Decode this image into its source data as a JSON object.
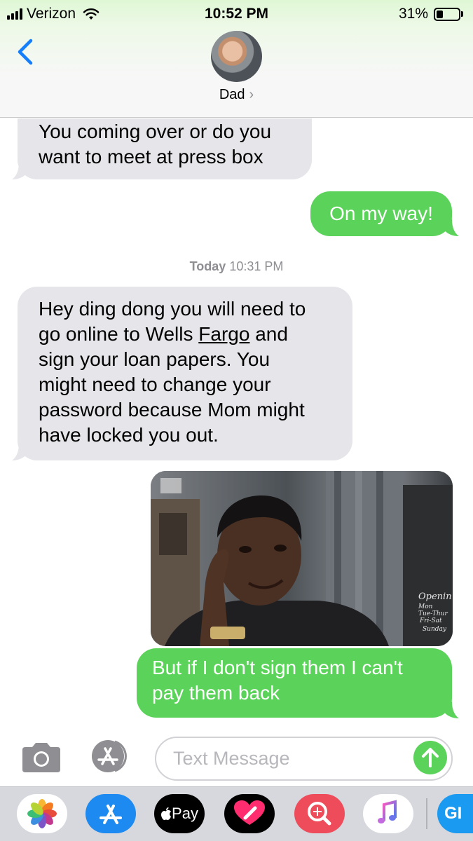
{
  "status_bar": {
    "carrier": "Verizon",
    "time": "10:52 PM",
    "battery_percent": "31%",
    "battery_level": 0.31,
    "signal_bars": 4,
    "icons": [
      "signal-icon",
      "wifi-icon",
      "battery-icon"
    ]
  },
  "header": {
    "contact_name": "Dad",
    "chevron": "›",
    "icons": [
      "back-chevron-icon",
      "contact-avatar"
    ]
  },
  "messages": {
    "m1": {
      "direction": "incoming",
      "lines": [
        "You coming over or do you",
        "want to meet at press box"
      ]
    },
    "m2": {
      "direction": "outgoing",
      "text": "On my way!"
    },
    "timestamp": {
      "day": "Today",
      "time": "10:31 PM"
    },
    "m3": {
      "direction": "incoming",
      "lines": {
        "l1": "Hey ding dong you will need to",
        "l2_before": "go online to Wells ",
        "l2_link": "Fargo",
        "l2_after": " and",
        "l3": "sign your loan papers. You",
        "l4": "might need to change your",
        "l5": "password because Mom might",
        "l6": "have locked you out."
      }
    },
    "gif": {
      "direction": "outgoing",
      "type": "image",
      "sign_lines": [
        "Openin",
        "Mon",
        "Tue-Thur",
        "Fri-Sat",
        "Sunday"
      ]
    },
    "m4": {
      "direction": "outgoing",
      "lines": [
        "But if I don't sign them I can't",
        "pay them back"
      ]
    }
  },
  "composer": {
    "placeholder": "Text Message",
    "icons": [
      "camera-icon",
      "app-store-icon",
      "send-arrow-icon"
    ]
  },
  "app_drawer": {
    "apple_pay_label": " Pay",
    "gif_label": "GI",
    "icons": [
      "photos-icon",
      "app-store-icon",
      "apple-pay-icon",
      "digital-touch-icon",
      "image-search-icon",
      "music-icon",
      "gif-icon"
    ]
  },
  "colors": {
    "outgoing_bubble": "#5bd35a",
    "incoming_bubble": "#e5e5ea",
    "ios_blue": "#147efb",
    "timestamp_gray": "#8e8e93"
  }
}
